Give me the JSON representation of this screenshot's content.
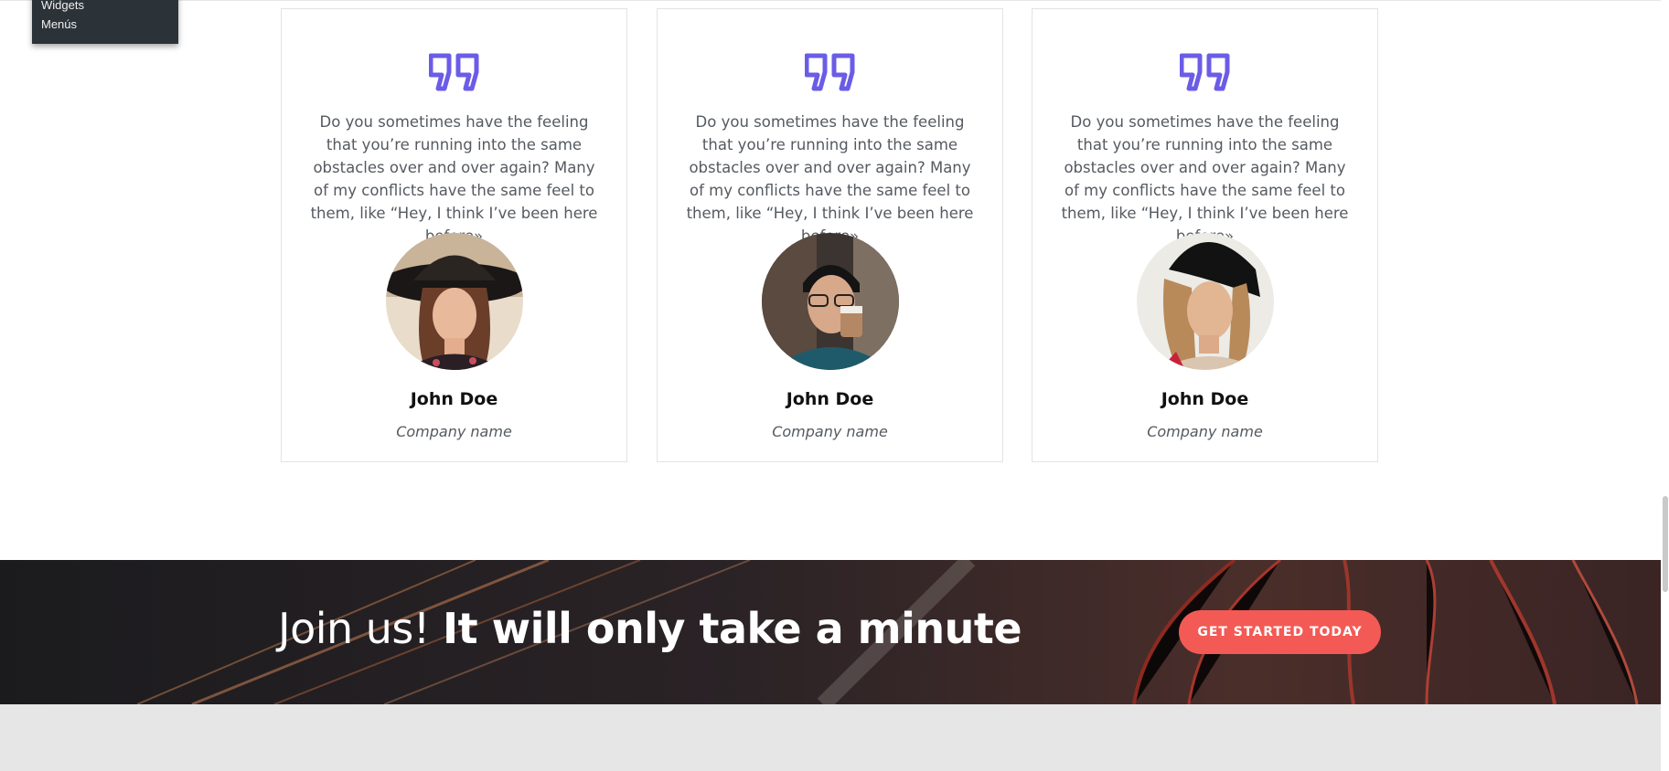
{
  "admin_menu": {
    "items": [
      "Widgets",
      "Menús"
    ]
  },
  "testimonials": [
    {
      "quote": "Do you sometimes have the feeling that you’re running into the same obstacles over and over again? Many of my conflicts have the same feel to them, like “Hey, I think I’ve been here before»",
      "name": "John Doe",
      "company": "Company name"
    },
    {
      "quote": "Do you sometimes have the feeling that you’re running into the same obstacles over and over again? Many of my conflicts have the same feel to them, like “Hey, I think I’ve been here before»",
      "name": "John Doe",
      "company": "Company name"
    },
    {
      "quote": "Do you sometimes have the feeling that you’re running into the same obstacles over and over again? Many of my conflicts have the same feel to them, like “Hey, I think I’ve been here before»",
      "name": "John Doe",
      "company": "Company name"
    }
  ],
  "cta": {
    "headline_light": "Join us! ",
    "headline_bold": "It will only take a minute",
    "button_label": "GET STARTED TODAY"
  },
  "colors": {
    "accent_purple": "#6b5ce7",
    "cta_button": "#f35a55",
    "card_border": "#e3e3e3"
  },
  "icons": {
    "quote": "quote-icon"
  }
}
